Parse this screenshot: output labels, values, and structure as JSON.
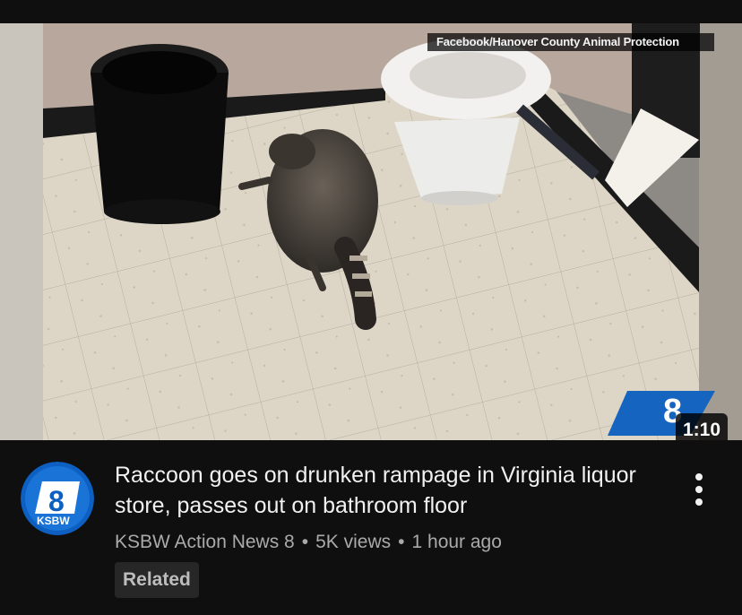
{
  "video": {
    "thumbnail": {
      "description_icon": "raccoon-on-bathroom-floor-image",
      "source_credit": "Facebook/Hanover County Animal Protection",
      "watermark": "8 KSBW",
      "duration": "1:10"
    },
    "title": "Raccoon goes on drunken rampage in Virginia liquor store, passes out on bathroom floor",
    "channel": "KSBW Action News 8",
    "views": "5K views",
    "age": "1 hour ago",
    "separator": "•",
    "badge": "Related",
    "avatar": {
      "number": "8",
      "label": "KSBW",
      "color": "#1565c0"
    },
    "more_icon": "more-vertical-icon"
  },
  "colors": {
    "background": "#0f0f0f",
    "title": "#f1f1f1",
    "meta": "#aaaaaa",
    "badge_bg": "#272727"
  }
}
